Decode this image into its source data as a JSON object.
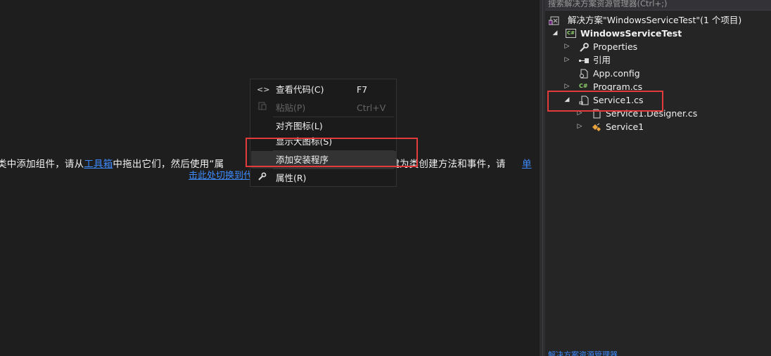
{
  "designer": {
    "hint_line1_prefix": "类中添加组件，请从",
    "hint_toolbox_link": "工具箱",
    "hint_line1_middle": "中拖出它们，然后使用“属",
    "hint_line1_suffix": "键为类创建方法和事件，请",
    "hint_right_link": "单",
    "hint_line2_link": "击此处切换到代码视图"
  },
  "solution_explorer": {
    "search_placeholder": "搜索解决方案资源管理器(Ctrl+;)",
    "solution_label": "解决方案\"WindowsServiceTest\"(1 个项目)",
    "project_label": "WindowsServiceTest",
    "project_icon_text": "C#",
    "items": [
      {
        "label": "Properties",
        "icon": "wrench-icon"
      },
      {
        "label": "引用",
        "icon": "references-icon"
      },
      {
        "label": "App.config",
        "icon": "config-file-icon"
      },
      {
        "label": "Program.cs",
        "icon": "csharp-file-icon"
      },
      {
        "label": "Service1.cs",
        "icon": "service-file-icon"
      },
      {
        "label": "Service1.Designer.cs",
        "icon": "document-icon"
      },
      {
        "label": "Service1",
        "icon": "class-icon"
      }
    ],
    "bottom_text": "解决方案资源管理器"
  },
  "context_menu": {
    "items": [
      {
        "label": "查看代码(C)",
        "shortcut": "F7",
        "icon": "code-icon",
        "enabled": true
      },
      {
        "label": "粘贴(P)",
        "shortcut": "Ctrl+V",
        "icon": "paste-icon",
        "enabled": false
      },
      {
        "label": "对齐图标(L)",
        "shortcut": "",
        "icon": "",
        "enabled": true
      },
      {
        "label": "显示大图标(S)",
        "shortcut": "",
        "icon": "",
        "enabled": true
      },
      {
        "label": "添加安装程序",
        "shortcut": "",
        "icon": "",
        "enabled": true
      },
      {
        "label": "属性(R)",
        "shortcut": "",
        "icon": "wrench-icon",
        "enabled": true
      }
    ]
  },
  "colors": {
    "background": "#1e1e1e",
    "panel": "#252526",
    "link": "#3e8bff",
    "highlight_box": "#e23b3b",
    "csharp_green": "#8ed16a"
  }
}
